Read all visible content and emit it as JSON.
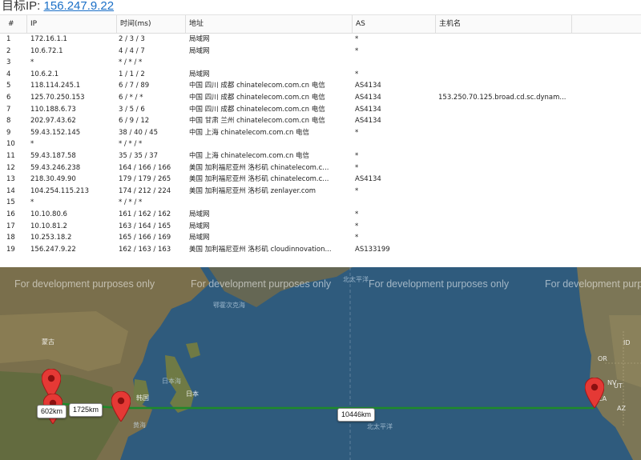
{
  "header": {
    "label": "目标IP:",
    "ip": "156.247.9.22"
  },
  "table": {
    "columns": [
      "#",
      "IP",
      "时间(ms)",
      "地址",
      "AS",
      "主机名"
    ],
    "rows": [
      [
        "1",
        "172.16.1.1",
        "2 / 3 / 3",
        "局域网",
        "*",
        ""
      ],
      [
        "2",
        "10.6.72.1",
        "4 / 4 / 7",
        "局域网",
        "*",
        ""
      ],
      [
        "3",
        "*",
        "* / * / *",
        "",
        "",
        ""
      ],
      [
        "4",
        "10.6.2.1",
        "1 / 1 / 2",
        "局域网",
        "*",
        ""
      ],
      [
        "5",
        "118.114.245.1",
        "6 / 7 / 89",
        "中国 四川 成都 chinatelecom.com.cn 电信",
        "AS4134",
        ""
      ],
      [
        "6",
        "125.70.250.153",
        "6 / * / *",
        "中国 四川 成都 chinatelecom.com.cn 电信",
        "AS4134",
        "153.250.70.125.broad.cd.sc.dynam..."
      ],
      [
        "7",
        "110.188.6.73",
        "3 / 5 / 6",
        "中国 四川 成都 chinatelecom.com.cn 电信",
        "AS4134",
        ""
      ],
      [
        "8",
        "202.97.43.62",
        "6 / 9 / 12",
        "中国 甘肃 兰州 chinatelecom.com.cn 电信",
        "AS4134",
        ""
      ],
      [
        "9",
        "59.43.152.145",
        "38 / 40 / 45",
        "中国 上海 chinatelecom.com.cn 电信",
        "*",
        ""
      ],
      [
        "10",
        "*",
        "* / * / *",
        "",
        "",
        ""
      ],
      [
        "11",
        "59.43.187.58",
        "35 / 35 / 37",
        "中国 上海 chinatelecom.com.cn 电信",
        "*",
        ""
      ],
      [
        "12",
        "59.43.246.238",
        "164 / 166 / 166",
        "美国 加利福尼亚州 洛杉矶 chinatelecom.c...",
        "*",
        ""
      ],
      [
        "13",
        "218.30.49.90",
        "179 / 179 / 265",
        "美国 加利福尼亚州 洛杉矶 chinatelecom.c...",
        "AS4134",
        ""
      ],
      [
        "14",
        "104.254.115.213",
        "174 / 212 / 224",
        "美国 加利福尼亚州 洛杉矶 zenlayer.com",
        "*",
        ""
      ],
      [
        "15",
        "*",
        "* / * / *",
        "",
        "",
        ""
      ],
      [
        "16",
        "10.10.80.6",
        "161 / 162 / 162",
        "局域网",
        "*",
        ""
      ],
      [
        "17",
        "10.10.81.2",
        "163 / 164 / 165",
        "局域网",
        "*",
        ""
      ],
      [
        "18",
        "10.253.18.2",
        "165 / 166 / 169",
        "局域网",
        "*",
        ""
      ],
      [
        "19",
        "156.247.9.22",
        "162 / 163 / 163",
        "美国 加利福尼亚州 洛杉矶 cloudinnovation...",
        "AS133199",
        ""
      ]
    ]
  },
  "map": {
    "watermark": "For development purposes only",
    "distances": [
      "602km",
      "1725km",
      "10446km"
    ],
    "labels": {
      "mongolia": "蒙古",
      "korea": "韩国",
      "japan": "日本",
      "sea_of_japan": "日本海",
      "yellow_sea": "黄海",
      "sea_okhotsk": "鄂霍次克海",
      "pacific_n": "北太平洋",
      "pacific": "北太平洋",
      "ca": "CA",
      "nv": "NV",
      "ut": "UT",
      "az": "AZ",
      "or": "OR",
      "id": "ID"
    },
    "colors": {
      "route": "#1e8a2a",
      "pin": "#e53935",
      "ocean": "#2f5b7d",
      "land": "#8a7a55"
    }
  }
}
